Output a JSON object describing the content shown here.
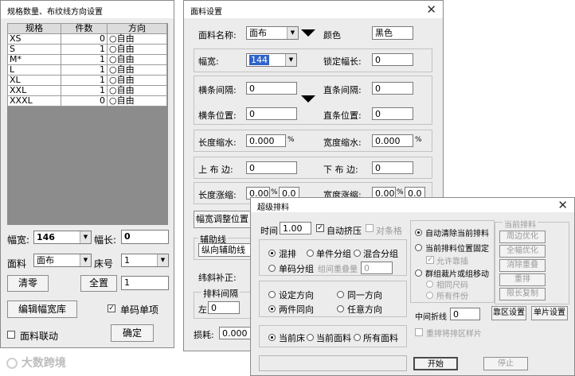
{
  "left_window": {
    "title": "规格数量、布纹线方向设置",
    "columns": [
      "规格",
      "件数",
      "方向"
    ],
    "rows": [
      {
        "size": "XS",
        "count": "0",
        "dir": "○自由"
      },
      {
        "size": "S",
        "count": "1",
        "dir": "○自由"
      },
      {
        "size": "M*",
        "count": "1",
        "dir": "○自由"
      },
      {
        "size": "L",
        "count": "1",
        "dir": "○自由"
      },
      {
        "size": "XL",
        "count": "1",
        "dir": "○自由"
      },
      {
        "size": "XXL",
        "count": "1",
        "dir": "○自由"
      },
      {
        "size": "XXXL",
        "count": "0",
        "dir": "○自由"
      }
    ],
    "width_label": "幅宽:",
    "width_value": "146",
    "length_label": "幅长:",
    "length_value": "0",
    "fabric_label": "面料",
    "fabric_value": "面布",
    "bed_label": "床号",
    "bed_value": "1",
    "clear_btn": "清零",
    "all_btn": "全置",
    "all_value": "1",
    "edit_width_btn": "编辑幅宽库",
    "single_size_label": "单码单项",
    "fabric_link_label": "面料联动",
    "ok_btn": "确定"
  },
  "fabric_window": {
    "title": "面料设置",
    "close": "✕",
    "name_label": "面料名称:",
    "name_value": "面布",
    "color_label": "颜色",
    "color_value": "黑色",
    "width_label": "幅宽:",
    "width_value": "144",
    "lock_length_label": "锁定幅长:",
    "lock_length_value": "0",
    "h_gap_label": "横条间隔:",
    "h_gap_value": "0",
    "v_gap_label": "直条间隔:",
    "v_gap_value": "0",
    "h_pos_label": "横条位置:",
    "h_pos_value": "0",
    "v_pos_label": "直条位置:",
    "v_pos_value": "0",
    "len_shrink_label": "长度缩水:",
    "len_shrink_value": "0.000",
    "width_shrink_label": "宽度缩水:",
    "width_shrink_value": "0.000",
    "pct": "%",
    "top_edge_label": "上 布 边:",
    "top_edge_value": "0",
    "bottom_edge_label": "下 布 边:",
    "bottom_edge_value": "0",
    "len_grow_label": "长度涨缩:",
    "len_grow_value": "0.000",
    "len_grow_value2": "0.0",
    "width_grow_label": "宽度涨缩:",
    "width_grow_value": "0.000",
    "width_grow_value2": "0.0",
    "width_adjust_btn": "幅宽调整位置",
    "aux_line_label": "辅助线",
    "aux_line_value": "纵向辅助线",
    "weft_label": "纬斜补正:",
    "layout_gap_label": "排料间隔",
    "left_label": "左",
    "left_value": "0",
    "loss_label": "损耗:",
    "loss_value": "0.000"
  },
  "marker_window": {
    "title": "超级排料",
    "close": "✕",
    "time_label": "时间",
    "time_value": "1.00",
    "auto_squeeze_label": "自动挤压",
    "align_label": "对条格",
    "radio_mix": "混排",
    "radio_single_group": "单件分组",
    "radio_mix_group": "混合分组",
    "radio_size_group": "单码分组",
    "group_repeat_label": "组间重叠量",
    "group_repeat_value": "0",
    "radio_set_dir": "设定方向",
    "radio_same_dir": "同一方向",
    "radio_pair_dir": "两件同向",
    "radio_any_dir": "任意方向",
    "radio_current_bed": "当前床",
    "radio_current_fabric": "当前面料",
    "radio_all_fabric": "所有面料",
    "opt_auto_clear": "自动清除当前排料",
    "opt_fix_pos": "当前排料位置固定",
    "opt_allow_scatter": "允许靠插",
    "opt_group_move": "群组裁片或组移动",
    "opt_same_size": "相同尺码",
    "opt_all_pieces": "所有件份",
    "side_group_title": "当前排料",
    "side_btn_1": "周边优化",
    "side_btn_2": "全幅优化",
    "side_btn_3": "消除重叠",
    "side_btn_4": "重排",
    "side_btn_5": "限长复制",
    "middle_fold_label": "中间折线",
    "middle_fold_value": "0",
    "block_btn": "靠区设置",
    "piece_btn": "单片设置",
    "repeat_line_label": "重排将排区样片",
    "start_btn": "开始",
    "stop_btn": "停止"
  },
  "watermark": "大数跨境"
}
